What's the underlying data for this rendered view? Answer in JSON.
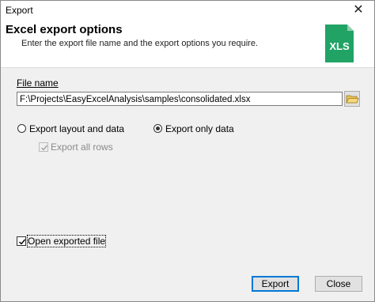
{
  "window": {
    "title": "Export",
    "close_glyph": "✕"
  },
  "header": {
    "title": "Excel export options",
    "subtitle": "Enter the export file name and the export options you require.",
    "icon": {
      "name": "xls-file-icon",
      "text": "XLS",
      "color": "#21a366"
    }
  },
  "file": {
    "label": "File name",
    "value": "F:\\Projects\\EasyExcelAnalysis\\samples\\consolidated.xlsx"
  },
  "options": {
    "export_layout_and_data": {
      "label": "Export layout and data",
      "selected": false
    },
    "export_only_data": {
      "label": "Export only data",
      "selected": true
    },
    "export_all_rows": {
      "label": "Export all rows",
      "checked": true,
      "enabled": false
    },
    "open_exported_file": {
      "label": "Open exported file",
      "checked": true
    }
  },
  "buttons": {
    "export": "Export",
    "close": "Close"
  }
}
